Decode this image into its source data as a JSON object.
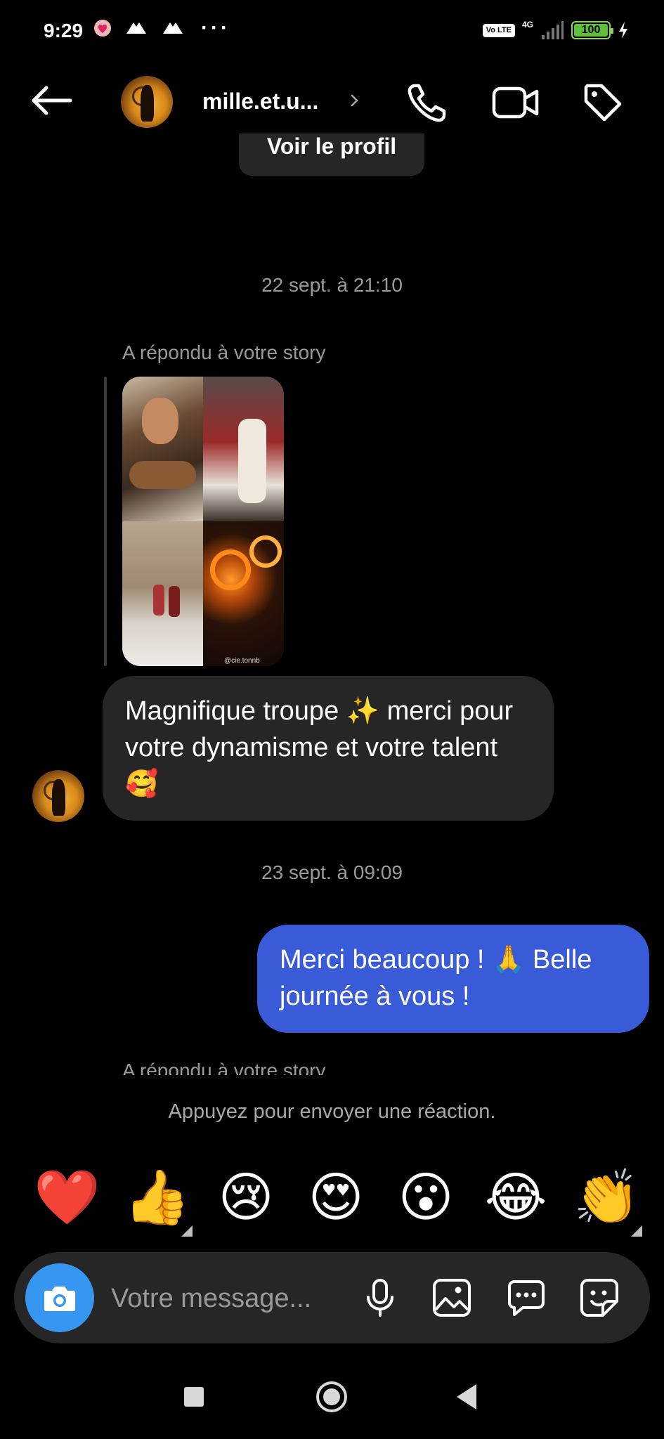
{
  "status_bar": {
    "time": "9:29",
    "network": "4G",
    "volte": "Vo LTE",
    "battery": "100"
  },
  "header": {
    "name": "mille.et.u...",
    "back_icon": "arrow-left-icon",
    "call_icon": "phone-icon",
    "video_icon": "video-camera-icon",
    "tag_icon": "tag-icon"
  },
  "chat": {
    "view_profile": "Voir le profil",
    "messages": [
      {
        "timestamp": "22 sept. à 21:10",
        "story_label": "A répondu à votre story",
        "story_caption": "@cie.tonnb",
        "text": "Magnifique troupe ✨ merci pour votre dynamisme et votre talent 🥰"
      },
      {
        "timestamp": "23 sept. à 09:09",
        "text": "Merci beaucoup ! 🙏 Belle journée à vous !"
      }
    ],
    "story_label_2": "A répondu à votre story"
  },
  "reactions": {
    "hint": "Appuyez pour envoyer une réaction.",
    "items": [
      "❤️",
      "👍",
      "😢",
      "😍",
      "😮",
      "😂",
      "👏"
    ]
  },
  "composer": {
    "placeholder": "Votre message..."
  },
  "colors": {
    "background": "#000000",
    "incoming_bubble": "#262626",
    "outgoing_bubble": "#3a5bd8",
    "camera_button": "#3797f0"
  }
}
